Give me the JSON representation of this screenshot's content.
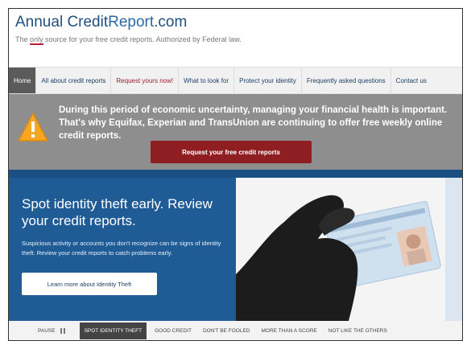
{
  "header": {
    "logo_part1": "Annual Credit",
    "logo_part2": "Report",
    "logo_part3": ".com",
    "tagline_pre": "The ",
    "tagline_u": "only",
    "tagline_post": " source for your free credit reports. Authorized by Federal law."
  },
  "nav": {
    "items": [
      {
        "label": "Home"
      },
      {
        "label": "All about credit reports"
      },
      {
        "label": "Request yours now!"
      },
      {
        "label": "What to look for"
      },
      {
        "label": "Protect your identity"
      },
      {
        "label": "Frequently asked questions"
      },
      {
        "label": "Contact us"
      }
    ]
  },
  "banner": {
    "text": "During this period of economic uncertainty, managing your financial health is important. That's why Equifax, Experian and TransUnion are continuing to offer free weekly online credit reports.",
    "button": "Request your free credit reports"
  },
  "hero": {
    "title": "Spot identity theft early. Review your credit reports.",
    "subtitle": "Suspicious activity or accounts you don't recognize can be signs of identity theft. Review your credit reports to catch problems early.",
    "button": "Learn more about Identity Theft"
  },
  "slider": {
    "pause": "PAUSE",
    "items": [
      {
        "label": "SPOT IDENTITY THEFT"
      },
      {
        "label": "GOOD CREDIT"
      },
      {
        "label": "DON'T BE FOOLED"
      },
      {
        "label": "MORE THAN A SCORE"
      },
      {
        "label": "NOT LIKE THE OTHERS"
      }
    ]
  },
  "colors": {
    "nav_active": "#5b5b5b",
    "banner_bg": "#8e8e8e",
    "button_red": "#8e1e22",
    "hero_blue": "#1f5b95"
  }
}
